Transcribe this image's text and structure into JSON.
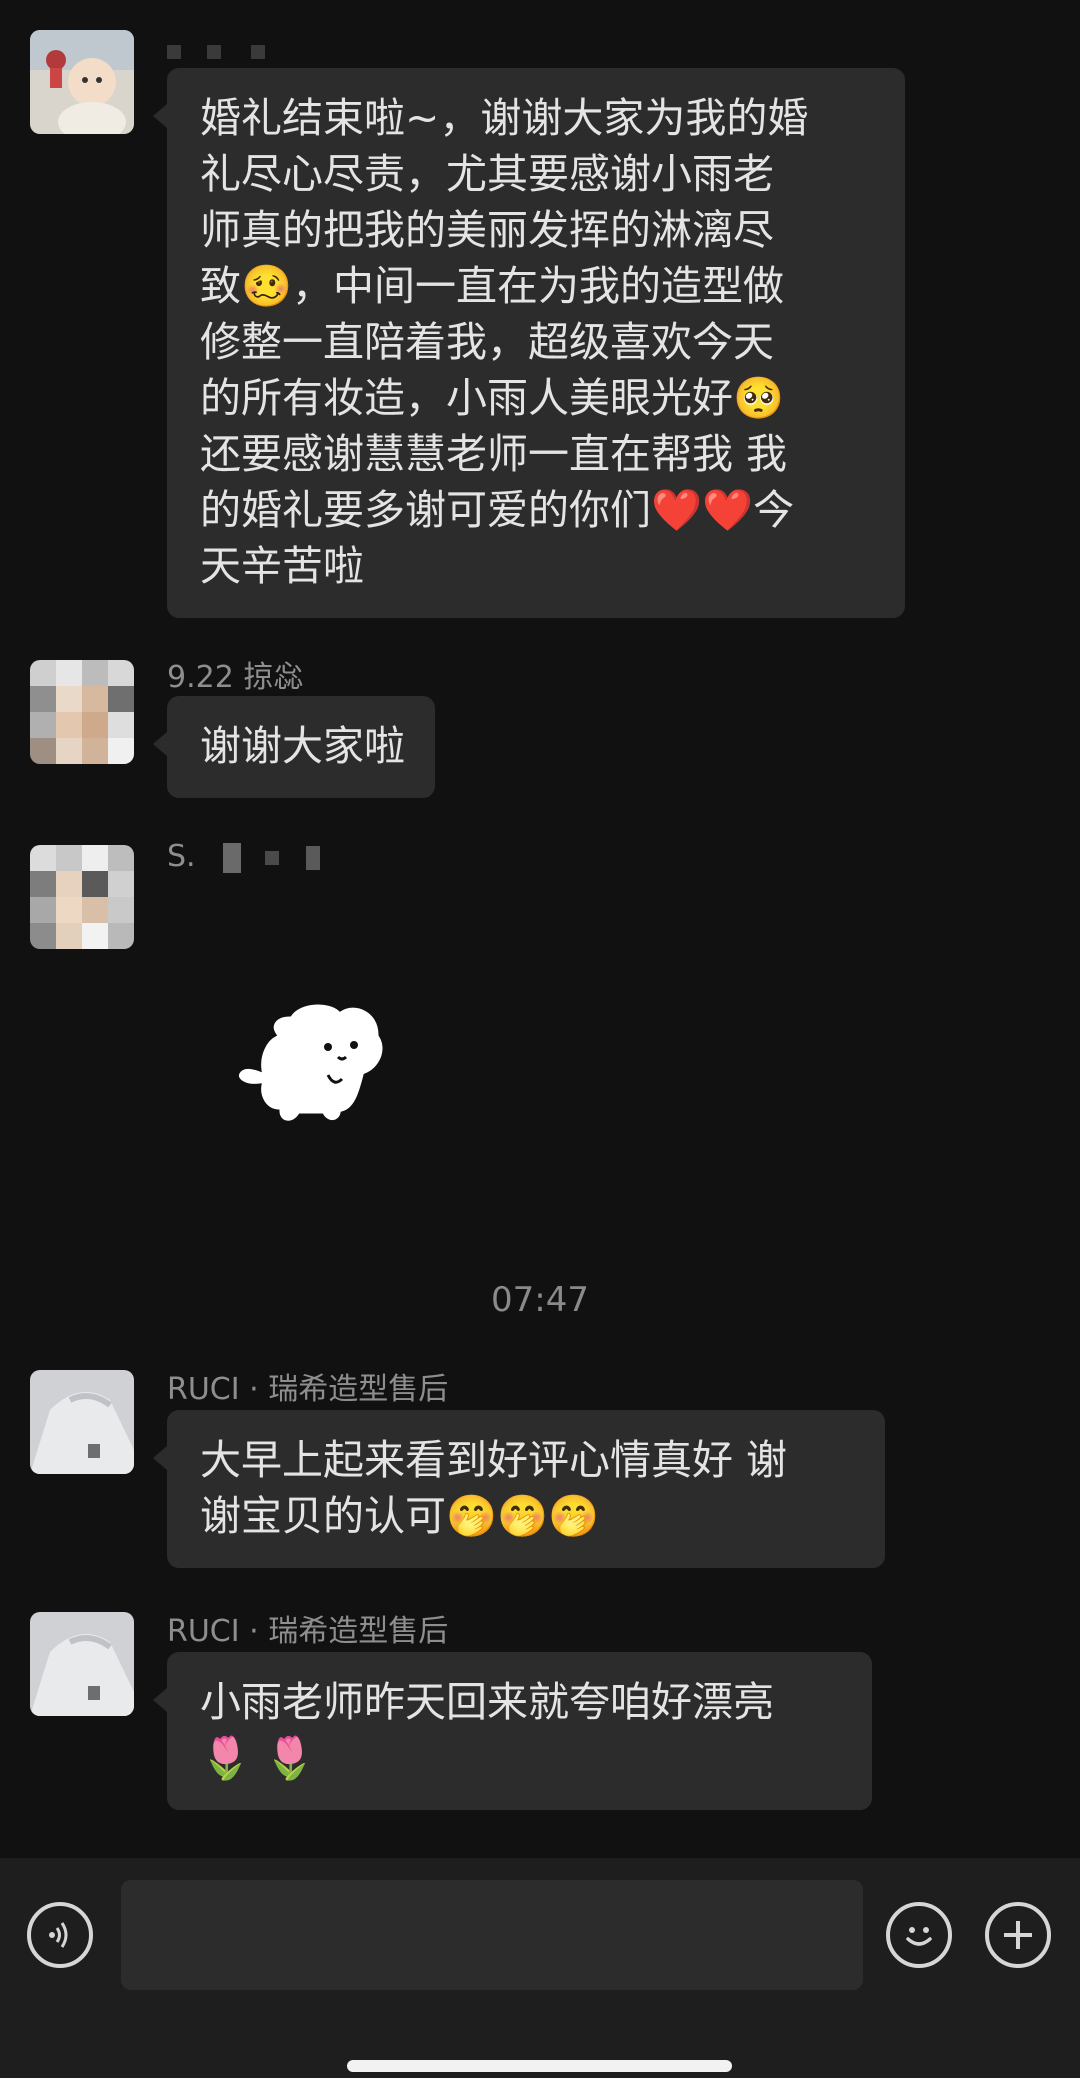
{
  "chat": {
    "messages": [
      {
        "sender": "",
        "lines": [
          "婚礼结束啦~，谢谢大家为我的婚",
          "礼尽心尽责，尤其要感谢小雨老",
          "师真的把我的美丽发挥的淋漓尽",
          "致🥴，中间一直在为我的造型做",
          "修整一直陪着我，超级喜欢今天",
          "的所有妆造，小雨人美眼光好🥺",
          "还要感谢慧慧老师一直在帮我 我",
          "的婚礼要多谢可爱的你们❤️❤️今",
          "天辛苦啦"
        ]
      },
      {
        "sender": "9.22 掠惢",
        "lines": [
          "谢谢大家啦"
        ]
      },
      {
        "sender": "S.",
        "sticker": "white-dog-sticker"
      },
      {
        "sender": "RUCI · 瑞希造型售后",
        "lines": [
          "大早上起来看到好评心情真好 谢",
          "谢宝贝的认可🤭🤭🤭"
        ]
      },
      {
        "sender": "RUCI · 瑞希造型售后",
        "lines": [
          "小雨老师昨天回来就夸咱好漂亮",
          "🌷 🌷"
        ]
      }
    ],
    "timestamp": "07:47"
  },
  "toolbar": {
    "voice_icon": "voice-icon",
    "emoji_icon": "emoji-icon",
    "plus_icon": "plus-icon",
    "input_placeholder": ""
  },
  "colors": {
    "background": "#111111",
    "bubble": "#2c2c2c",
    "toolbar": "#1e1e1e",
    "text": "#e4e4e4",
    "meta_text": "#8e8e8e"
  }
}
